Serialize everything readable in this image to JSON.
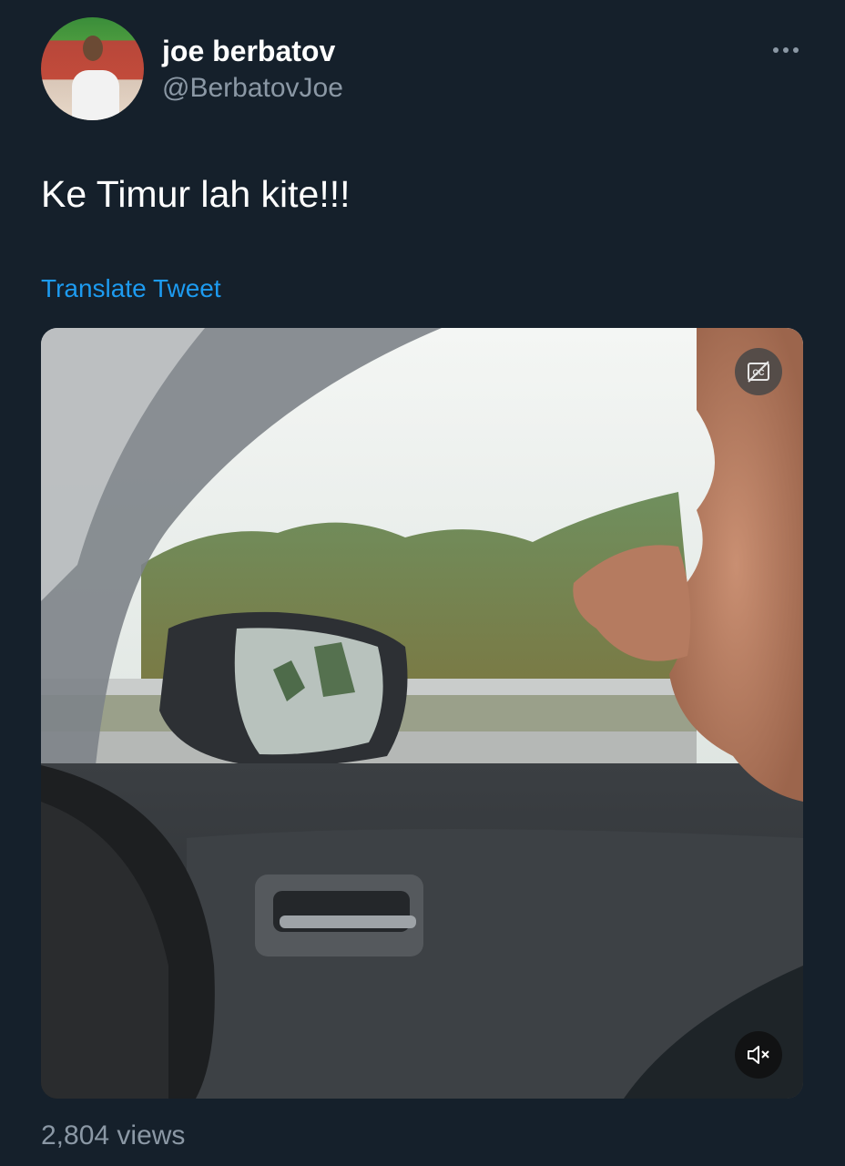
{
  "author": {
    "display_name": "joe berbatov",
    "handle": "@BerbatovJoe",
    "avatar_icon": "profile-photo"
  },
  "tweet": {
    "text": "Ke Timur lah kite!!!",
    "translate_label": "Translate Tweet",
    "views": "2,804 views"
  },
  "media": {
    "type": "video",
    "captions_icon": "captions-off-icon",
    "mute_icon": "volume-muted-icon"
  },
  "colors": {
    "background": "#15202b",
    "link": "#1d9bf0",
    "secondary_text": "#8b98a5"
  }
}
